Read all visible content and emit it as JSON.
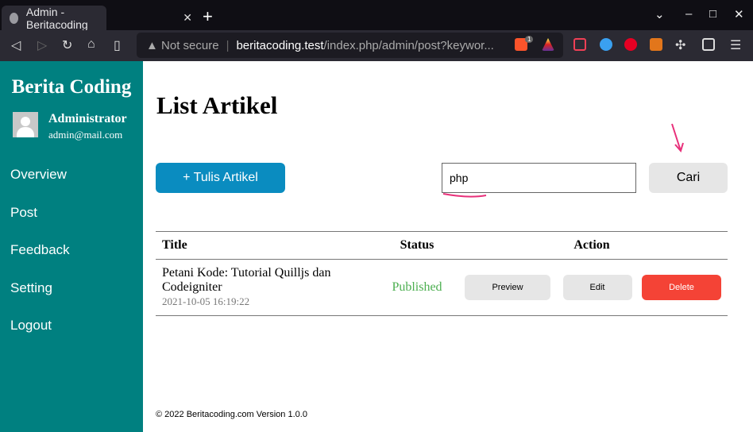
{
  "browser": {
    "tab_title": "Admin - Beritacoding",
    "security": "Not secure",
    "url_host": "beritacoding.test",
    "url_path": "/index.php/admin/post?keywor...",
    "brave_badge": "1"
  },
  "sidebar": {
    "brand": "Berita Coding",
    "user_name": "Administrator",
    "user_email": "admin@mail.com",
    "items": [
      {
        "label": "Overview"
      },
      {
        "label": "Post"
      },
      {
        "label": "Feedback"
      },
      {
        "label": "Setting"
      },
      {
        "label": "Logout"
      }
    ]
  },
  "main": {
    "title": "List Artikel",
    "add_label": "+ Tulis Artikel",
    "search_value": "php",
    "search_label": "Cari",
    "table": {
      "headers": [
        "Title",
        "Status",
        "Action"
      ],
      "rows": [
        {
          "title": "Petani Kode: Tutorial Quilljs dan Codeigniter",
          "date": "2021-10-05 16:19:22",
          "status": "Published",
          "preview": "Preview",
          "edit": "Edit",
          "delete": "Delete"
        }
      ]
    }
  },
  "footer": "© 2022 Beritacoding.com Version 1.0.0",
  "colors": {
    "sidebar": "#008080",
    "primary": "#0a8cc0",
    "danger": "#f44336",
    "published": "#4caf50",
    "annotation": "#e8307a"
  }
}
